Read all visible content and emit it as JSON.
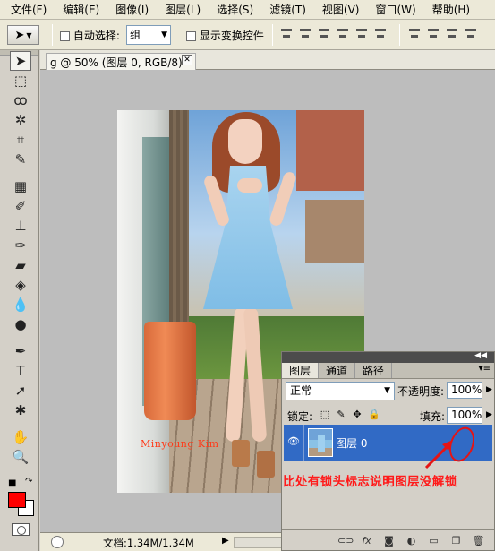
{
  "menubar": {
    "items": [
      {
        "label": "文件(F)"
      },
      {
        "label": "编辑(E)"
      },
      {
        "label": "图像(I)"
      },
      {
        "label": "图层(L)"
      },
      {
        "label": "选择(S)"
      },
      {
        "label": "滤镜(T)"
      },
      {
        "label": "视图(V)"
      },
      {
        "label": "窗口(W)"
      },
      {
        "label": "帮助(H)"
      }
    ]
  },
  "options": {
    "auto_select_label": "自动选择:",
    "auto_select_value": "组",
    "show_transform_label": "显示变换控件"
  },
  "document": {
    "tab_title": "g @ 50% (图层 0, RGB/8) *",
    "close_glyph": "✕",
    "watermark": "Minyoung Kim"
  },
  "status": {
    "doc_size": "文档:1.34M/1.34M",
    "arrow": "▶"
  },
  "layers_panel": {
    "tabs": [
      {
        "label": "图层"
      },
      {
        "label": "通道"
      },
      {
        "label": "路径"
      }
    ],
    "blend_mode": "正常",
    "opacity_label": "不透明度:",
    "opacity_value": "100%",
    "lock_label": "锁定:",
    "fill_label": "填充:",
    "fill_value": "100%",
    "layer": {
      "name": "图层 0"
    }
  },
  "annotation": {
    "text": "比处有锁头标志说明图层没解锁",
    "color": "#ff1a1a"
  },
  "colors": {
    "foreground": "#ff0000",
    "background": "#ffffff",
    "selection": "#316ac5"
  }
}
